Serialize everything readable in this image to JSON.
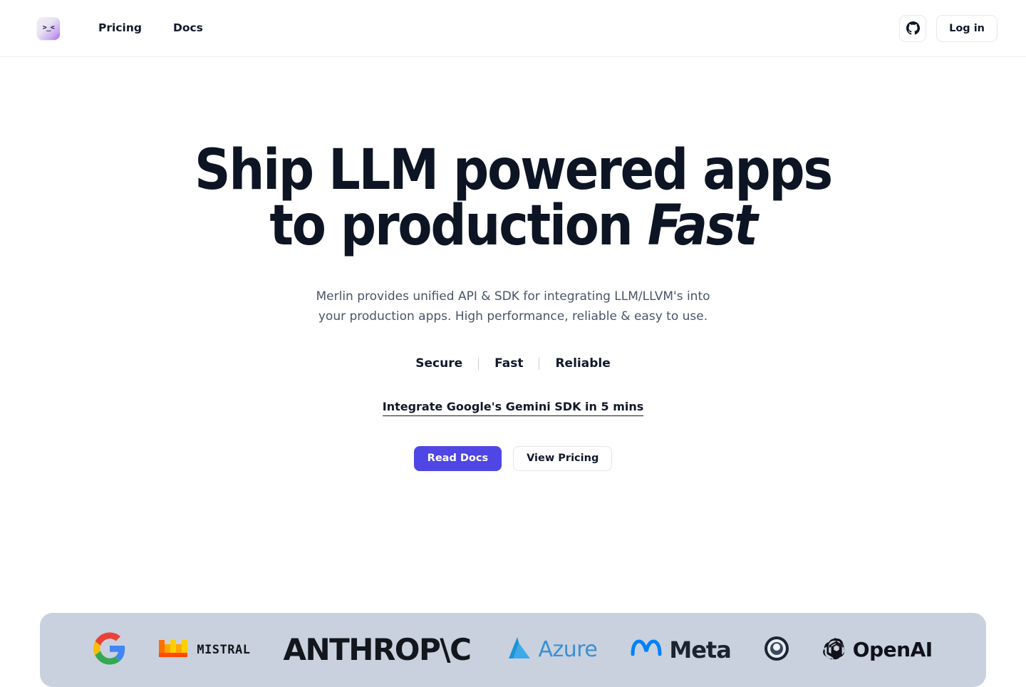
{
  "header": {
    "logo_glyph": ">‿<",
    "logo_name": "merlin-logo",
    "nav": [
      {
        "label": "Pricing",
        "name": "nav-pricing"
      },
      {
        "label": "Docs",
        "name": "nav-docs"
      }
    ],
    "github_icon": "github-icon",
    "login_label": "Log in"
  },
  "hero": {
    "title_line1": "Ship LLM powered apps",
    "title_line2_prefix": "to production ",
    "title_line2_italic": "Fast",
    "subtitle_line1": "Merlin provides unified API & SDK for integrating LLM/LLVM's into",
    "subtitle_line2": "your production apps. High performance, reliable & easy to use.",
    "feature_tags": [
      "Secure",
      "Fast",
      "Reliable"
    ],
    "link_text": "Integrate Google's Gemini SDK in 5 mins",
    "primary_cta": "Read Docs",
    "secondary_cta": "View Pricing"
  },
  "logo_strip": {
    "background": "#c9d1de",
    "logos": [
      {
        "name": "google-logo",
        "text": ""
      },
      {
        "name": "mistral-logo",
        "text": "MISTRAL"
      },
      {
        "name": "anthropic-logo",
        "text": "ANTHROP\\C"
      },
      {
        "name": "azure-logo",
        "text": "Azure"
      },
      {
        "name": "meta-logo",
        "text": "Meta"
      },
      {
        "name": "groq-logo",
        "text": ""
      },
      {
        "name": "openai-logo",
        "text": "OpenAI"
      }
    ]
  },
  "colors": {
    "primary_button": "#4f46e5",
    "heading": "#0d1424",
    "subtitle": "#475569",
    "strip_bg": "#c9d1de"
  }
}
